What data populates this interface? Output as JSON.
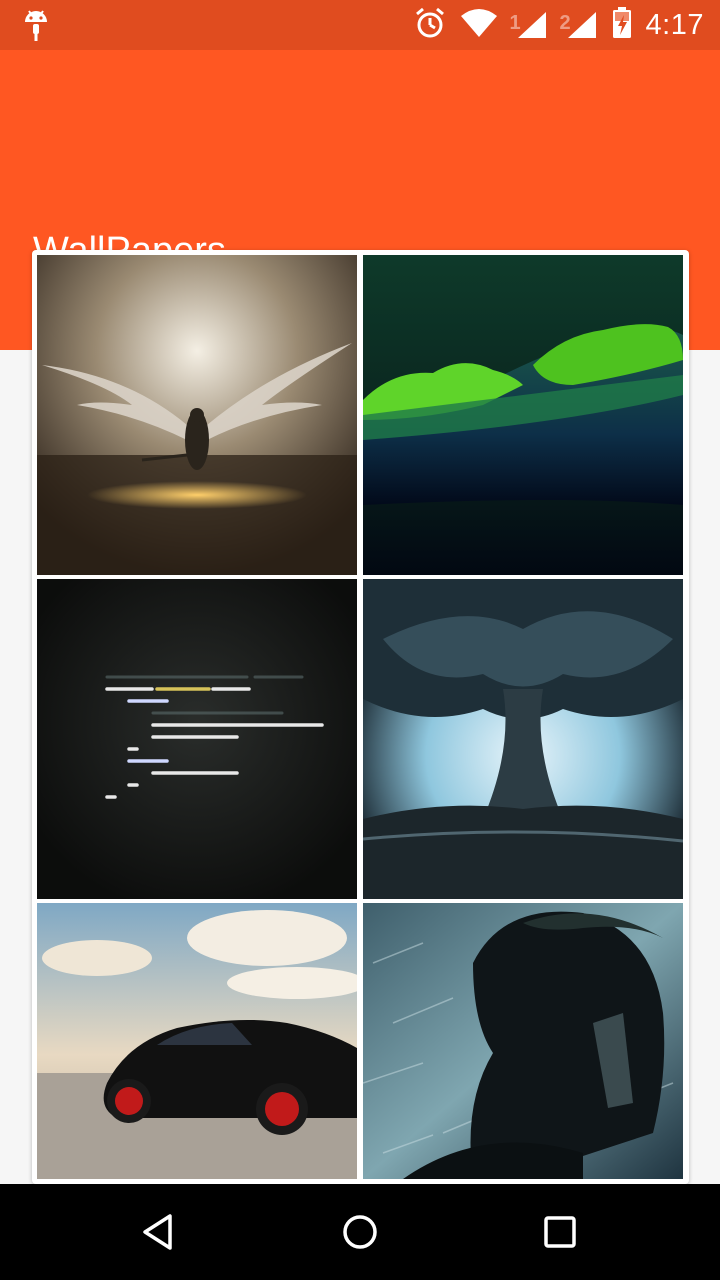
{
  "status_bar": {
    "time": "4:17",
    "sim1_label": "1",
    "sim2_label": "2",
    "icons": [
      "android-debug-icon",
      "alarm-icon",
      "wifi-icon",
      "signal-icon",
      "battery-charging-icon"
    ]
  },
  "app_bar": {
    "title": "WallPapers",
    "color": "#ff5722",
    "status_color": "#e04c1f"
  },
  "wallpapers": [
    {
      "subject": "winged angel warrior"
    },
    {
      "subject": "green moss on log"
    },
    {
      "subject": "code snippet on dark background"
    },
    {
      "subject": "giant tree"
    },
    {
      "subject": "black sports car"
    },
    {
      "subject": "spartan helmet"
    }
  ],
  "nav_bar": {
    "icons": [
      "back-icon",
      "home-icon",
      "recents-icon"
    ]
  }
}
